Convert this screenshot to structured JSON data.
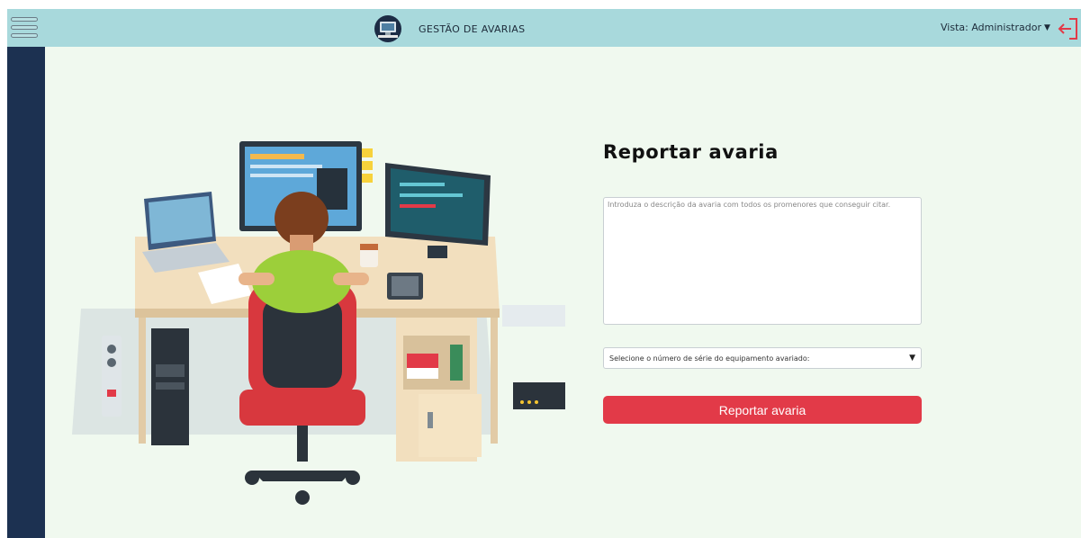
{
  "header": {
    "title": "GESTÃO DE AVARIAS",
    "view_label": "Vista: Administrador",
    "background": "#a8d9dc"
  },
  "sidebar": {
    "background": "#1c3151"
  },
  "form": {
    "heading": "Reportar avaria",
    "description_placeholder": "Introduza o descrição da avaria com todos os promenores que conseguir citar.",
    "serial_select_value": "Selecione o número de série do equipamento avariado:",
    "submit_label": "Reportar avaria",
    "accent": "#e23a48"
  },
  "icons": {
    "menu": "hamburger-icon",
    "logo": "computer-logo-icon",
    "view_chevron": "chevron-down-icon",
    "logout": "logout-icon",
    "select_chevron": "chevron-down-icon"
  }
}
